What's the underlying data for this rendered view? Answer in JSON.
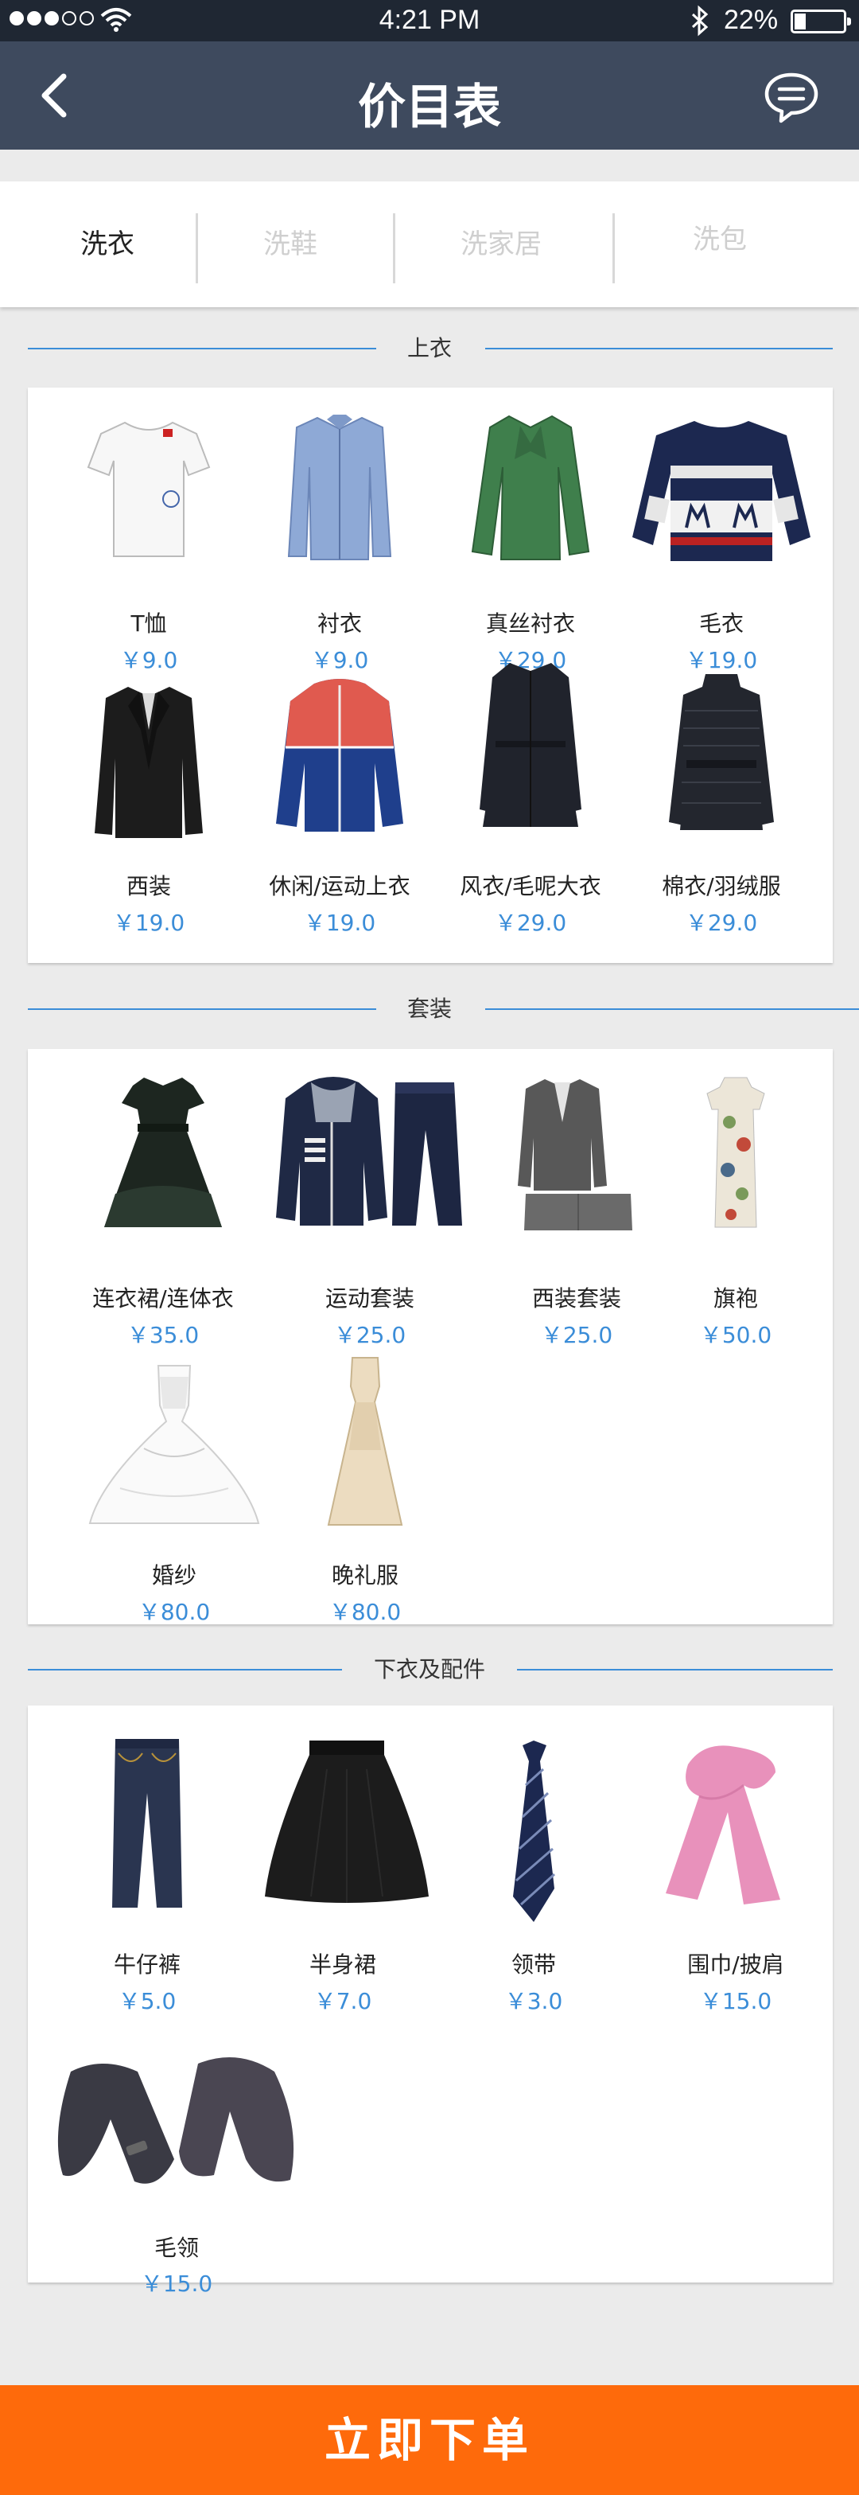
{
  "status_bar": {
    "time": "4:21 PM",
    "battery": "22%"
  },
  "nav": {
    "title": "价目表"
  },
  "tabs": [
    {
      "label": "洗衣"
    },
    {
      "label": "洗鞋"
    },
    {
      "label": "洗家居"
    },
    {
      "label": "洗包"
    }
  ],
  "sections": [
    {
      "title": "上衣",
      "items": [
        {
          "name": "T恤",
          "price": "￥9.0",
          "icon": "tshirt-image"
        },
        {
          "name": "衬衣",
          "price": "￥9.0",
          "icon": "shirt-image"
        },
        {
          "name": "真丝衬衣",
          "price": "￥29.0",
          "icon": "silk-shirt-image"
        },
        {
          "name": "毛衣",
          "price": "￥19.0",
          "icon": "sweater-image"
        },
        {
          "name": "西装",
          "price": "￥19.0",
          "icon": "suit-jacket-image"
        },
        {
          "name": "休闲/运动上衣",
          "price": "￥19.0",
          "icon": "sport-jacket-image"
        },
        {
          "name": "风衣/毛呢大衣",
          "price": "￥29.0",
          "icon": "trench-coat-image"
        },
        {
          "name": "棉衣/羽绒服",
          "price": "￥29.0",
          "icon": "down-coat-image"
        }
      ]
    },
    {
      "title": "套装",
      "items": [
        {
          "name": "连衣裙/连体衣",
          "price": "￥35.0",
          "icon": "dress-image"
        },
        {
          "name": "运动套装",
          "price": "￥25.0",
          "icon": "tracksuit-image"
        },
        {
          "name": "西装套装",
          "price": "￥25.0",
          "icon": "business-suit-image"
        },
        {
          "name": "旗袍",
          "price": "￥50.0",
          "icon": "qipao-image"
        },
        {
          "name": "婚纱",
          "price": "￥80.0",
          "icon": "wedding-dress-image"
        },
        {
          "name": "晚礼服",
          "price": "￥80.0",
          "icon": "evening-gown-image"
        }
      ]
    },
    {
      "title": "下衣及配件",
      "items": [
        {
          "name": "牛仔裤",
          "price": "￥5.0",
          "icon": "jeans-image"
        },
        {
          "name": "半身裙",
          "price": "￥7.0",
          "icon": "skirt-image"
        },
        {
          "name": "领带",
          "price": "￥3.0",
          "icon": "tie-image"
        },
        {
          "name": "围巾/披肩",
          "price": "￥15.0",
          "icon": "scarf-image"
        },
        {
          "name": "毛领",
          "price": "￥15.0",
          "icon": "fur-collar-image"
        }
      ]
    }
  ],
  "order_button": {
    "label": "立即下单"
  },
  "colors": {
    "nav": "#3e4a5e",
    "status": "#1f2733",
    "accent_blue": "#3b8dd8",
    "order": "#fe6a0b"
  }
}
